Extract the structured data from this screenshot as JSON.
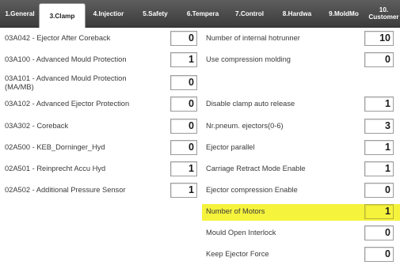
{
  "tabs": [
    {
      "label": "1.General"
    },
    {
      "label": "3.Clamp"
    },
    {
      "label": "4.Injectior"
    },
    {
      "label": "5.Safety"
    },
    {
      "label": "6.Tempera"
    },
    {
      "label": "7.Control"
    },
    {
      "label": "8.Hardwa"
    },
    {
      "label": "9.MoldMo"
    },
    {
      "label_line1": "10.",
      "label_line2": "Customer"
    }
  ],
  "left_params": [
    {
      "label": "03A042 - Ejector After Coreback",
      "value": "0"
    },
    {
      "label": "03A100 - Advanced Mould Protection",
      "value": "1"
    },
    {
      "label_line1": "03A101 - Advanced Mould Protection",
      "label_line2": "(MA/MB)",
      "value": "0"
    },
    {
      "label": "03A102 - Advanced Ejector Protection",
      "value": "0"
    },
    {
      "label": "03A302 - Coreback",
      "value": "0"
    },
    {
      "label": "02A500 - KEB_Dorninger_Hyd",
      "value": "0"
    },
    {
      "label": "02A501 - Reinprecht Accu Hyd",
      "value": "1"
    },
    {
      "label": "02A502 - Additional Pressure Sensor",
      "value": "1"
    }
  ],
  "right_params": [
    {
      "label": "Number of internal hotrunner",
      "value": "10"
    },
    {
      "label": "Use compression molding",
      "value": "0"
    },
    {
      "label": "Disable clamp auto release",
      "value": "1"
    },
    {
      "label": "Nr.pneum. ejectors(0-6)",
      "value": "3"
    },
    {
      "label": "Ejector parallel",
      "value": "1"
    },
    {
      "label": "Carriage Retract Mode Enable",
      "value": "1"
    },
    {
      "label": "Ejector compression Enable",
      "value": "0"
    },
    {
      "label": "Number of Motors",
      "value": "1"
    },
    {
      "label": "Mould Open Interlock",
      "value": "0"
    },
    {
      "label": "Keep Ejector Force",
      "value": "0"
    }
  ],
  "colors": {
    "highlight": "#f5f33b",
    "tabbar": "#4a4a4a"
  }
}
